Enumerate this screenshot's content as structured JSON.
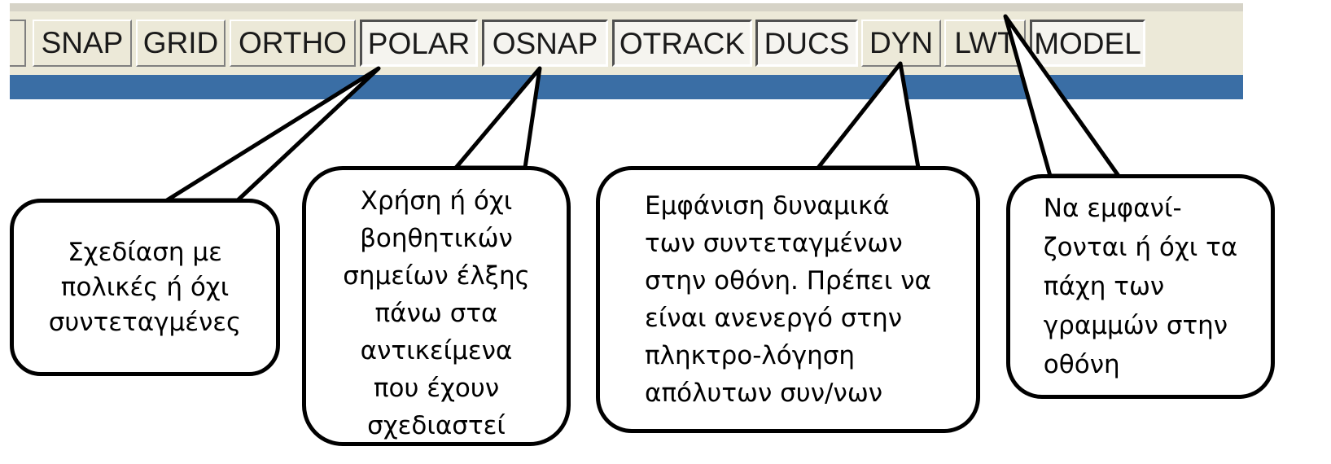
{
  "status_bar": {
    "buttons": [
      {
        "label": "SNAP",
        "state": "raised"
      },
      {
        "label": "GRID",
        "state": "raised"
      },
      {
        "label": "ORTHO",
        "state": "raised"
      },
      {
        "label": "POLAR",
        "state": "pressed"
      },
      {
        "label": "OSNAP",
        "state": "pressed"
      },
      {
        "label": "OTRACK",
        "state": "pressed"
      },
      {
        "label": "DUCS",
        "state": "pressed"
      },
      {
        "label": "DYN",
        "state": "raised"
      },
      {
        "label": "LWT",
        "state": "raised"
      },
      {
        "label": "MODEL",
        "state": "pressed"
      }
    ],
    "colors": {
      "bar": "#ece9d8",
      "strip": "#3a6ea5"
    }
  },
  "callouts": {
    "polar": [
      "Σχεδίαση με",
      "πολικές ή όχι",
      "συντεταγμένες"
    ],
    "osnap": [
      "Χρήση ή όχι",
      "βοηθητικών",
      "σημείων έλξης",
      "πάνω στα",
      "αντικείμενα",
      "που έχουν",
      "σχεδιαστεί"
    ],
    "dyn": [
      "Εμφάνιση δυναμικά",
      "των συντεταγμένων",
      "στην οθόνη. Πρέπει να",
      "είναι ανενεργό στην",
      "πληκτρο-λόγηση",
      "απόλυτων συν/νων"
    ],
    "lwt": [
      "Να εμφανί-",
      "ζονται ή όχι τα",
      "πάχη των",
      "γραμμών στην",
      "οθόνη"
    ]
  }
}
